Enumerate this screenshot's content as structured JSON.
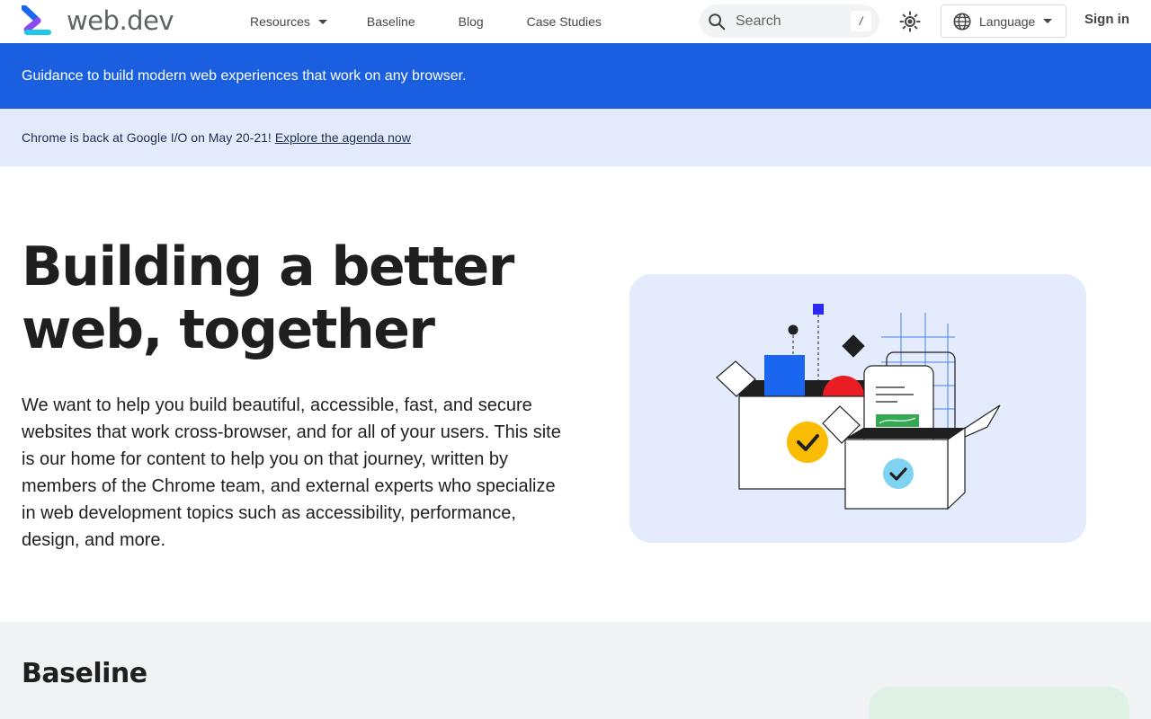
{
  "header": {
    "logo_text": "web.dev",
    "nav": [
      {
        "label": "Resources"
      },
      {
        "label": "Baseline"
      },
      {
        "label": "Blog"
      },
      {
        "label": "Case Studies"
      }
    ],
    "search": {
      "placeholder": "Search",
      "shortcut": "/"
    },
    "language_label": "Language",
    "signin_label": "Sign in"
  },
  "banner": {
    "tagline": "Guidance to build modern web experiences that work on any browser."
  },
  "announcement": {
    "text": "Chrome is back at Google I/O on May 20-21!",
    "link": "Explore the agenda now"
  },
  "hero": {
    "title_line1": "Building a better",
    "title_line2": "web, together",
    "body": "We want to help you build beautiful, accessible, fast, and secure websites that work cross-browser, and for all of your users. This site is our home for content to help you on that journey, written by members of the Chrome team, and external experts who specialize in web development topics such as accessibility, performance, design, and more."
  },
  "baseline": {
    "title": "Baseline"
  },
  "colors": {
    "brand_blue": "#1a5fe0",
    "announce_bg": "#e2eafc",
    "illustration_bg": "#e3ebfc",
    "check_yellow": "#fbbc04",
    "check_cyan": "#7fd3f0",
    "shape_red": "#ea1c24",
    "shape_blue": "#1a66f0",
    "doc_green": "#34a853"
  },
  "icons": {
    "search": "search-icon",
    "theme": "sun-icon",
    "language": "globe-icon",
    "caret": "chevron-down-icon"
  }
}
